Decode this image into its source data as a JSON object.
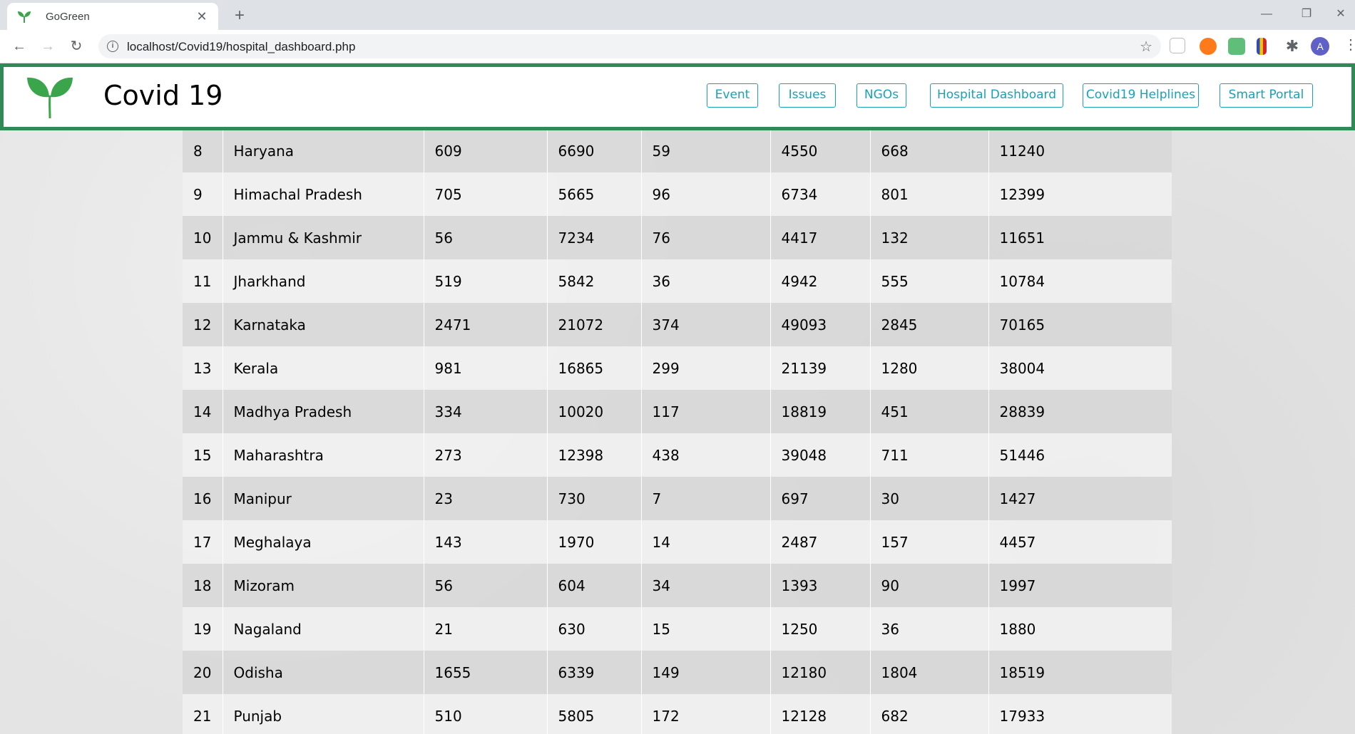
{
  "browser": {
    "tab_title": "GoGreen",
    "url": "localhost/Covid19/hospital_dashboard.php",
    "profile_initial": "A"
  },
  "site": {
    "title": "Covid 19",
    "nav": [
      "Event",
      "Issues",
      "NGOs",
      "Hospital Dashboard",
      "Covid19 Helplines",
      "Smart Portal"
    ]
  },
  "table": {
    "rows": [
      [
        "8",
        "Haryana",
        "609",
        "6690",
        "59",
        "4550",
        "668",
        "11240"
      ],
      [
        "9",
        "Himachal Pradesh",
        "705",
        "5665",
        "96",
        "6734",
        "801",
        "12399"
      ],
      [
        "10",
        "Jammu & Kashmir",
        "56",
        "7234",
        "76",
        "4417",
        "132",
        "11651"
      ],
      [
        "11",
        "Jharkhand",
        "519",
        "5842",
        "36",
        "4942",
        "555",
        "10784"
      ],
      [
        "12",
        "Karnataka",
        "2471",
        "21072",
        "374",
        "49093",
        "2845",
        "70165"
      ],
      [
        "13",
        "Kerala",
        "981",
        "16865",
        "299",
        "21139",
        "1280",
        "38004"
      ],
      [
        "14",
        "Madhya Pradesh",
        "334",
        "10020",
        "117",
        "18819",
        "451",
        "28839"
      ],
      [
        "15",
        "Maharashtra",
        "273",
        "12398",
        "438",
        "39048",
        "711",
        "51446"
      ],
      [
        "16",
        "Manipur",
        "23",
        "730",
        "7",
        "697",
        "30",
        "1427"
      ],
      [
        "17",
        "Meghalaya",
        "143",
        "1970",
        "14",
        "2487",
        "157",
        "4457"
      ],
      [
        "18",
        "Mizoram",
        "56",
        "604",
        "34",
        "1393",
        "90",
        "1997"
      ],
      [
        "19",
        "Nagaland",
        "21",
        "630",
        "15",
        "1250",
        "36",
        "1880"
      ],
      [
        "20",
        "Odisha",
        "1655",
        "6339",
        "149",
        "12180",
        "1804",
        "18519"
      ],
      [
        "21",
        "Punjab",
        "510",
        "5805",
        "172",
        "12128",
        "682",
        "17933"
      ]
    ]
  },
  "colors": {
    "header_border": "#2e8b57",
    "nav_accent": "#17a2b8",
    "leaf": "#3aa54a"
  }
}
